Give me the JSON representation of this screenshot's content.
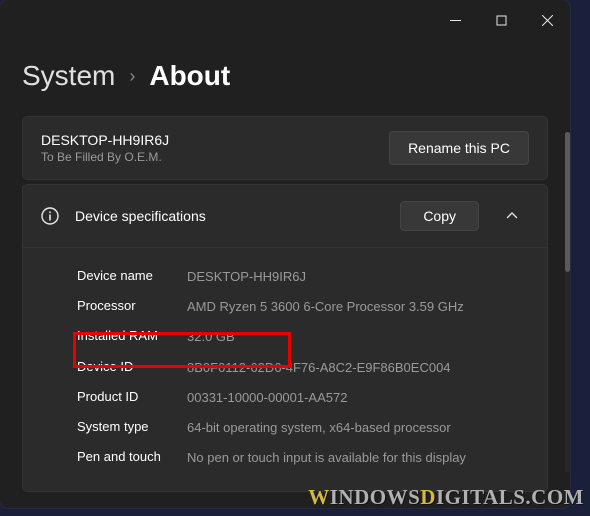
{
  "breadcrumb": {
    "parent": "System",
    "current": "About"
  },
  "pc": {
    "name": "DESKTOP-HH9IR6J",
    "sub": "To Be Filled By O.E.M."
  },
  "buttons": {
    "rename": "Rename this PC",
    "copy": "Copy"
  },
  "card": {
    "title": "Device specifications"
  },
  "specs": {
    "device_name_label": "Device name",
    "device_name_value": "DESKTOP-HH9IR6J",
    "processor_label": "Processor",
    "processor_value": "AMD Ryzen 5 3600 6-Core Processor 3.59 GHz",
    "ram_label": "Installed RAM",
    "ram_value": "32.0 GB",
    "device_id_label": "Device ID",
    "device_id_value": "8B0F0112-62D6-4F76-A8C2-E9F86B0EC004",
    "product_id_label": "Product ID",
    "product_id_value": "00331-10000-00001-AA572",
    "system_type_label": "System type",
    "system_type_value": "64-bit operating system, x64-based processor",
    "pen_label": "Pen and touch",
    "pen_value": "No pen or touch input is available for this display"
  },
  "watermark": {
    "w": "W",
    "mid": "INDOWS",
    "d": "D",
    "rest": "IGITALS.COM"
  }
}
